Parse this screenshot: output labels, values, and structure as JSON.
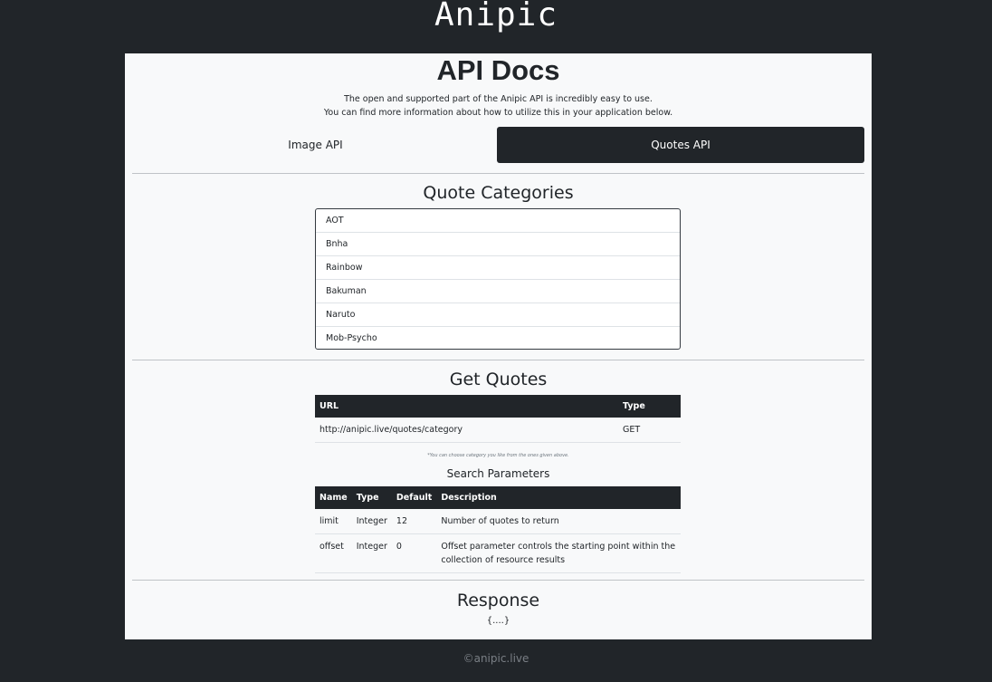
{
  "brand": "Anipic",
  "page_title": "API Docs",
  "intro": {
    "line1": "The open and supported part of the Anipic API is incredibly easy to use.",
    "line2": "You can find more information about how to utilize this in your application below."
  },
  "tabs": [
    {
      "label": "Image API",
      "active": false
    },
    {
      "label": "Quotes API",
      "active": true
    }
  ],
  "categories": {
    "title": "Quote Categories",
    "items": [
      "AOT",
      "Bnha",
      "Rainbow",
      "Bakuman",
      "Naruto",
      "Mob-Psycho"
    ]
  },
  "get_quotes": {
    "title": "Get Quotes",
    "headers": [
      "URL",
      "Type"
    ],
    "row": {
      "url": "http://anipic.live/quotes/category",
      "type": "GET"
    },
    "note": "*You can choose category you like from the ones given above."
  },
  "search_params": {
    "title": "Search Parameters",
    "headers": [
      "Name",
      "Type",
      "Default",
      "Description"
    ],
    "rows": [
      {
        "name": "limit",
        "type": "Integer",
        "default": "12",
        "description": "Number of quotes to return"
      },
      {
        "name": "offset",
        "type": "Integer",
        "default": "0",
        "description": "Offset parameter controls the starting point within the collection of resource results"
      }
    ]
  },
  "response": {
    "title": "Response",
    "body": "{....}"
  },
  "footer": "©anipic.live",
  "colors": {
    "dark": "#212529",
    "card": "#f8f9fa",
    "footer_text": "#7a7f85"
  }
}
